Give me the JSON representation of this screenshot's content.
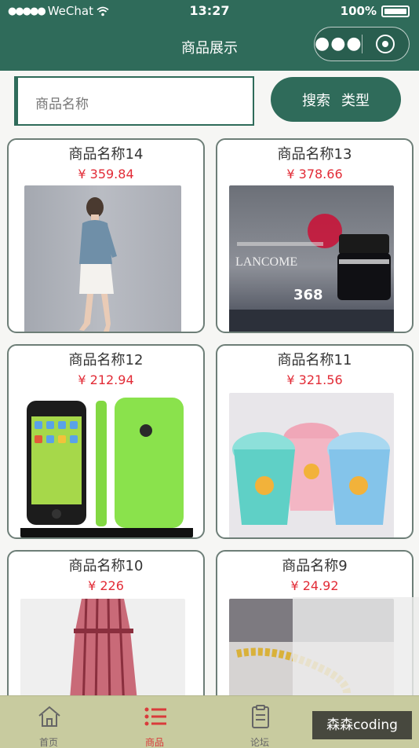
{
  "status_bar": {
    "carrier": "WeChat",
    "time": "13:27",
    "battery": "100%"
  },
  "nav": {
    "title": "商品展示",
    "more_icon": "more-dots-icon",
    "close_icon": "target-circle-icon"
  },
  "search": {
    "placeholder": "商品名称",
    "button_search": "搜索",
    "button_type": "类型"
  },
  "products": [
    {
      "name": "商品名称14",
      "price": "¥ 359.84",
      "image": "woman-in-denim-shirt-photo"
    },
    {
      "name": "商品名称13",
      "price": "¥ 378.66",
      "image": "lancome-cosmetics-ad"
    },
    {
      "name": "商品名称12",
      "price": "¥ 212.94",
      "image": "green-smartphone-photo"
    },
    {
      "name": "商品名称11",
      "price": "¥ 321.56",
      "image": "plastic-cups-photo"
    },
    {
      "name": "商品名称10",
      "price": "¥ 226",
      "image": "red-dress-photo"
    },
    {
      "name": "商品名称9",
      "price": "¥ 24.92",
      "image": "gold-bracelet-photo"
    }
  ],
  "ad_text": {
    "brand": "LANCOME",
    "price_number": "368"
  },
  "tabs": [
    {
      "label": "首页",
      "icon": "home-icon",
      "active": false
    },
    {
      "label": "商品",
      "icon": "list-icon",
      "active": true
    },
    {
      "label": "论坛",
      "icon": "document-icon",
      "active": false
    }
  ],
  "watermark": "森森coding",
  "colors": {
    "theme": "#2f6b5a",
    "price": "#e22b36",
    "tab_bar": "#c8cb9f",
    "tab_active": "#d93b3b"
  }
}
